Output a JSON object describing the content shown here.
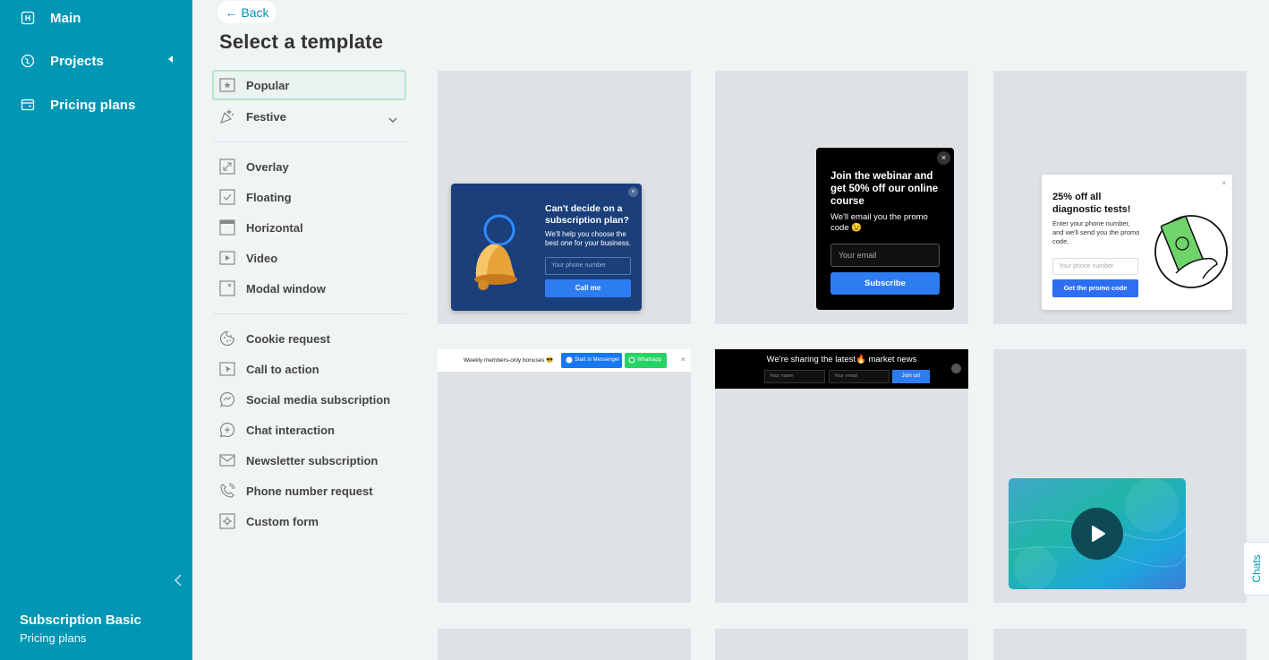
{
  "sidebar": {
    "items": [
      {
        "label": "Main",
        "icon": "home-icon"
      },
      {
        "label": "Projects",
        "icon": "globe-icon"
      },
      {
        "label": "Pricing plans",
        "icon": "wallet-icon"
      }
    ],
    "plan_name": "Subscription Basic",
    "plan_link": "Pricing plans"
  },
  "header": {
    "back_label": "← Back",
    "title": "Select a template"
  },
  "categories": [
    {
      "label": "Popular",
      "icon": "star-icon",
      "active": true
    },
    {
      "label": "Festive",
      "icon": "party-icon"
    },
    {
      "label": "Overlay",
      "icon": "expand-icon"
    },
    {
      "label": "Floating",
      "icon": "check-square-icon"
    },
    {
      "label": "Horizontal",
      "icon": "horizontal-bar-icon"
    },
    {
      "label": "Video",
      "icon": "play-icon"
    },
    {
      "label": "Modal window",
      "icon": "modal-icon"
    },
    {
      "label": "Cookie request",
      "icon": "cookie-icon"
    },
    {
      "label": "Call to action",
      "icon": "cursor-icon"
    },
    {
      "label": "Social media subscription",
      "icon": "messenger-icon"
    },
    {
      "label": "Chat interaction",
      "icon": "chat-plus-icon"
    },
    {
      "label": "Newsletter subscription",
      "icon": "envelope-icon"
    },
    {
      "label": "Phone number request",
      "icon": "phone-icon"
    },
    {
      "label": "Custom form",
      "icon": "gear-box-icon"
    }
  ],
  "templates": {
    "t1": {
      "title": "Can't decide on a subscription plan?",
      "text": "We'll help you choose the best one for your business.",
      "input_placeholder": "Your phone number",
      "button": "Call me"
    },
    "t2": {
      "title": "Join the webinar and get 50% off our online course",
      "text": "We'll email you the promo code 😉",
      "input_placeholder": "Your email",
      "button": "Subscribe"
    },
    "t3": {
      "title": "25% off all diagnostic tests!",
      "text": "Enter your phone number, and we'll send you the promo code.",
      "input_placeholder": "Your phone number",
      "button": "Get the promo code"
    },
    "t4": {
      "text": "Weekly members-only bonuses 😎",
      "button1": "Start in Messenger",
      "button2": "Whatsapp"
    },
    "t5": {
      "text": "We're sharing the latest🔥 market news",
      "input1": "Your name",
      "input2": "Your email",
      "button": "Join us!"
    }
  },
  "chats_label": "Chats",
  "colors": {
    "sidebar": "#0096b4",
    "accent_blue": "#2d7df0",
    "active_border": "#b8e6c8"
  }
}
